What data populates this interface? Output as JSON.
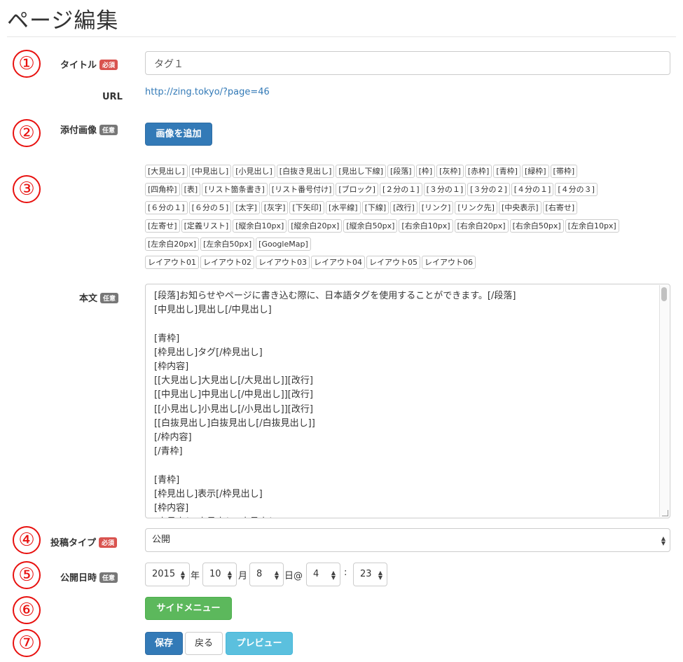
{
  "page_title": "ページ編集",
  "markers": [
    "①",
    "②",
    "③",
    "④",
    "⑤",
    "⑥",
    "⑦"
  ],
  "labels": {
    "title": "タイトル",
    "url": "URL",
    "image": "添付画像",
    "body": "本文",
    "post_type": "投稿タイプ",
    "publish_date": "公開日時"
  },
  "badges": {
    "required": "必須",
    "optional": "任意"
  },
  "title_input": {
    "value": "タグ１"
  },
  "url_link": "http://zing.tokyo/?page=46",
  "add_image_button": "画像を追加",
  "tag_rows": [
    [
      "[大見出し]",
      "[中見出し]",
      "[小見出し]",
      "[白抜き見出し]",
      "[見出し下線]",
      "[段落]",
      "[枠]",
      "[灰枠]",
      "[赤枠]",
      "[青枠]",
      "[緑枠]",
      "[帯枠]"
    ],
    [
      "[四角枠]",
      "[表]",
      "[リスト箇条書き]",
      "[リスト番号付け]",
      "[ブロック]",
      "[２分の１]",
      "[３分の１]",
      "[３分の２]",
      "[４分の１]",
      "[４分の３]"
    ],
    [
      "[６分の１]",
      "[６分の５]",
      "[太字]",
      "[灰字]",
      "[下矢印]",
      "[水平線]",
      "[下線]",
      "[改行]",
      "[リンク]",
      "[リンク先]",
      "[中央表示]",
      "[右寄せ]"
    ],
    [
      "[左寄せ]",
      "[定義リスト]",
      "[縦余白10px]",
      "[縦余白20px]",
      "[縦余白50px]",
      "[右余白10px]",
      "[右余白20px]",
      "[右余白50px]",
      "[左余白10px]"
    ],
    [
      "[左余白20px]",
      "[左余白50px]",
      "[GoogleMap]"
    ],
    [
      "レイアウト01",
      "レイアウト02",
      "レイアウト03",
      "レイアウト04",
      "レイアウト05",
      "レイアウト06"
    ]
  ],
  "body_text": "[段落]お知らせやページに書き込む際に、日本語タグを使用することができます。[/段落]\n[中見出し]見出し[/中見出し]\n\n[青枠]\n[枠見出し]タグ[/枠見出し]\n[枠内容]\n[[大見出し]大見出し[/大見出し]][改行]\n[[中見出し]中見出し[/中見出し]][改行]\n[[小見出し]小見出し[/小見出し]][改行]\n[[白抜見出し]白抜見出し[/白抜見出し]]\n[/枠内容]\n[/青枠]\n\n[青枠]\n[枠見出し]表示[/枠見出し]\n[枠内容]\n[大見出し]大見出し[/大見出し]",
  "post_type": {
    "value": "公開"
  },
  "date": {
    "year": "2015",
    "year_suffix": "年",
    "month": "10",
    "month_suffix": "月",
    "day": "8",
    "day_suffix": "日@",
    "hour": "4",
    "time_sep": ":",
    "minute": "23"
  },
  "side_menu_button": "サイドメニュー",
  "actions": {
    "save": "保存",
    "back": "戻る",
    "preview": "プレビュー"
  }
}
